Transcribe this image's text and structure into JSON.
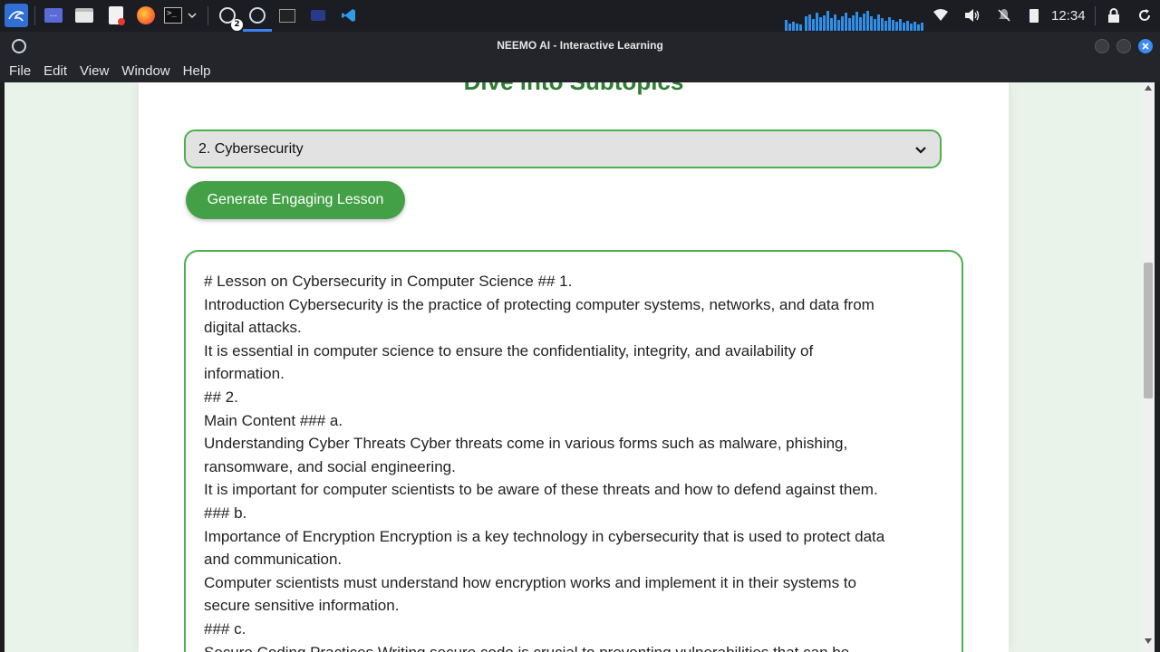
{
  "taskbar": {
    "clock": "12:34",
    "launchers": [
      "kali-menu-icon",
      "workspace-icon",
      "file-manager-icon",
      "text-editor-icon",
      "firefox-icon",
      "terminal-icon",
      "chevron-down-icon",
      "chatgpt-icon",
      "neemo-app-icon",
      "terminal-window-icon",
      "workspace-switch-icon",
      "vscode-icon"
    ],
    "badge": "2",
    "accent": "#3b82f6"
  },
  "window": {
    "title": "NEEMO AI - Interactive Learning"
  },
  "menubar": {
    "items": [
      "File",
      "Edit",
      "View",
      "Window",
      "Help"
    ]
  },
  "page": {
    "section_heading": "Dive into Subtopics",
    "subtopic_select": {
      "selected": "2. Cybersecurity"
    },
    "generate_button": "Generate Engaging Lesson",
    "lesson_lines": [
      "# Lesson on Cybersecurity in Computer Science ## 1.",
      "Introduction Cybersecurity is the practice of protecting computer systems, networks, and data from",
      "digital attacks.",
      "It is essential in computer science to ensure the confidentiality, integrity, and availability of",
      "information.",
      "## 2.",
      "Main Content ### a.",
      "Understanding Cyber Threats Cyber threats come in various forms such as malware, phishing,",
      "ransomware, and social engineering.",
      "It is important for computer scientists to be aware of these threats and how to defend against them.",
      "### b.",
      "Importance of Encryption Encryption is a key technology in cybersecurity that is used to protect data",
      "and communication.",
      "Computer scientists must understand how encryption works and implement it in their systems to",
      "secure sensitive information.",
      "### c.",
      "Secure Coding Practices Writing secure code is crucial to preventing vulnerabilities that can be"
    ],
    "colors": {
      "accent_green": "#4caf50",
      "button_green": "#43a047",
      "heading_green": "#2e7d32",
      "page_background": "#eaf3ea"
    }
  }
}
